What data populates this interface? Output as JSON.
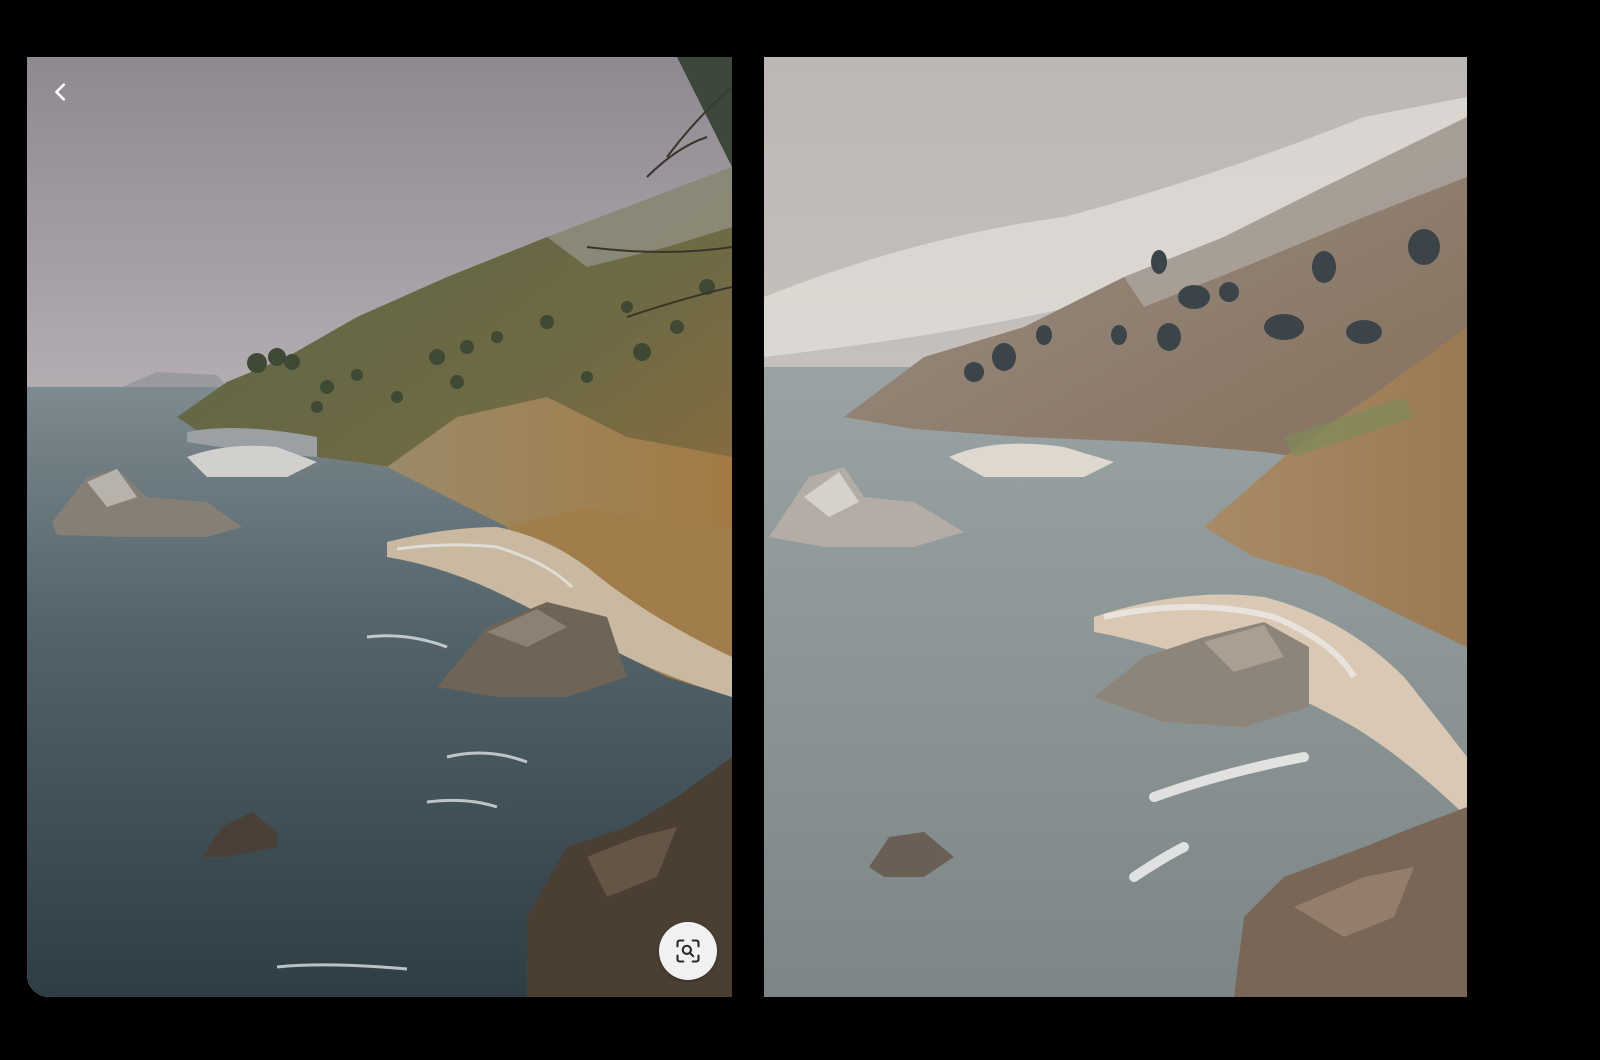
{
  "viewer": {
    "back_icon": "chevron-left-icon",
    "lens_icon": "image-search-icon",
    "back_label": "",
    "lens_label": ""
  },
  "images": [
    {
      "kind": "photo",
      "subject": "coastal-cliffs-and-cove"
    },
    {
      "kind": "painting",
      "subject": "coastal-cliffs-and-cove"
    }
  ],
  "colors": {
    "background": "#000000",
    "lens_button": "#f1f1f1",
    "icon_light": "#ffffff",
    "icon_dark": "#2a2a2a"
  }
}
